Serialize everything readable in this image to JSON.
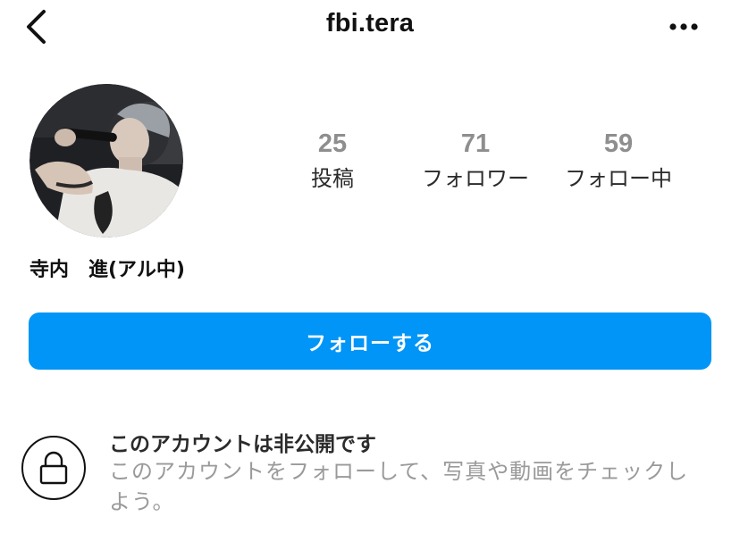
{
  "header": {
    "title": "fbi.tera",
    "back_icon": "chevron-left-icon",
    "more_icon": "ellipsis-horizontal-icon"
  },
  "profile": {
    "avatar": "profile-photo",
    "display_name": "寺内　進(アル中)"
  },
  "stats": {
    "posts": {
      "count": "25",
      "label": "投稿"
    },
    "followers": {
      "count": "71",
      "label": "フォロワー"
    },
    "following": {
      "count": "59",
      "label": "フォロー中"
    }
  },
  "actions": {
    "follow_label": "フォローする"
  },
  "private_notice": {
    "icon": "lock-icon",
    "title": "このアカウントは非公開です",
    "description": "このアカウントをフォローして、写真や動画をチェックしよう。"
  },
  "colors": {
    "accent": "#0095f6",
    "count_gray": "#8e8e8e",
    "muted_text": "#9a9a9a"
  }
}
